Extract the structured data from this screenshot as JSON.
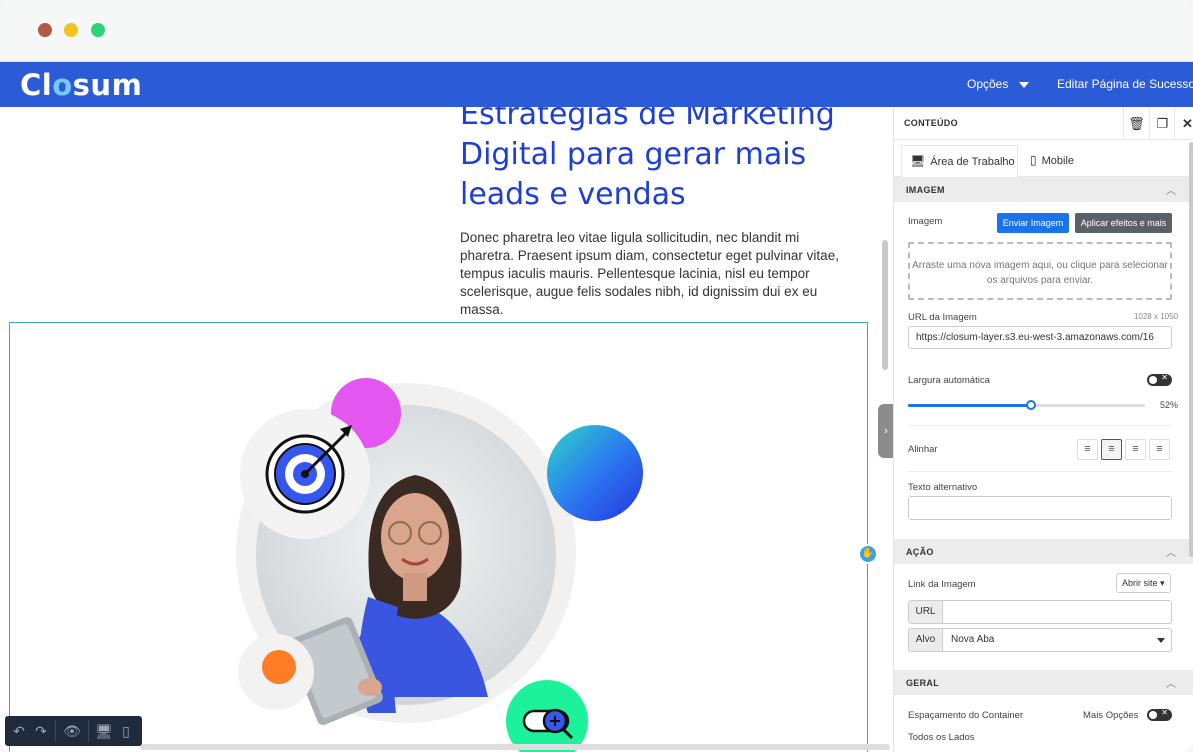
{
  "window": {
    "controls": [
      "close",
      "minimize",
      "maximize"
    ]
  },
  "appbar": {
    "logo": "Closum",
    "options_label": "Opções",
    "edit_success_label": "Editar Página de Sucesso →"
  },
  "canvas": {
    "hero_title": "Estratégias de Marketing Digital para gerar mais leads e vendas",
    "hero_text": "Donec pharetra leo vitae ligula sollicitudin, nec blandit mi pharetra. Praesent ipsum diam, consectetur eget pulvinar vitae, tempus iaculis mauris. Pellentesque lacinia, nisl eu tempor scelerisque, augue felis sodales nibh, id dignissim dui ex eu massa."
  },
  "bottom_toolbar": {
    "icons": [
      "undo-icon",
      "redo-icon",
      "eye-icon",
      "desktop-icon",
      "mobile-icon"
    ]
  },
  "panel": {
    "title": "CONTEÚDO",
    "tabs": [
      {
        "label": "Área de Trabalho",
        "active": true
      },
      {
        "label": "Mobile",
        "active": false
      }
    ],
    "sections": {
      "imagem": {
        "heading": "IMAGEM",
        "image_label": "Imagem",
        "upload_button": "Enviar Imagem",
        "effects_button": "Aplicar efeitos e mais",
        "dropzone_text": "Arraste uma nova imagem aqui, ou clique para selecionar os arquivos para enviar.",
        "url_label": "URL da Imagem",
        "dimensions": "1028 x 1050",
        "url_value": "https://closum-layer.s3.eu-west-3.amazonaws.com/16",
        "auto_width_label": "Largura automática",
        "auto_width_enabled": false,
        "width_percent": 52,
        "width_value_text": "52%",
        "align_label": "Alinhar",
        "align_selected": "center",
        "alt_label": "Texto alternativo",
        "alt_value": ""
      },
      "acao": {
        "heading": "AÇÃO",
        "link_label": "Link da Imagem",
        "link_mode": "Abrir site",
        "url_addon": "URL",
        "url_value": "",
        "target_addon": "Alvo",
        "target_value": "Nova Aba"
      },
      "geral": {
        "heading": "GERAL",
        "spacing_label": "Espaçamento do Container",
        "more_options_label": "Mais Opções",
        "all_sides_label": "Todos os Lados"
      }
    }
  },
  "colors": {
    "brand_blue": "#2b5bd7",
    "title_blue": "#1e3fd6",
    "primary_button": "#1a73e8",
    "selection": "#3aa3dc"
  }
}
